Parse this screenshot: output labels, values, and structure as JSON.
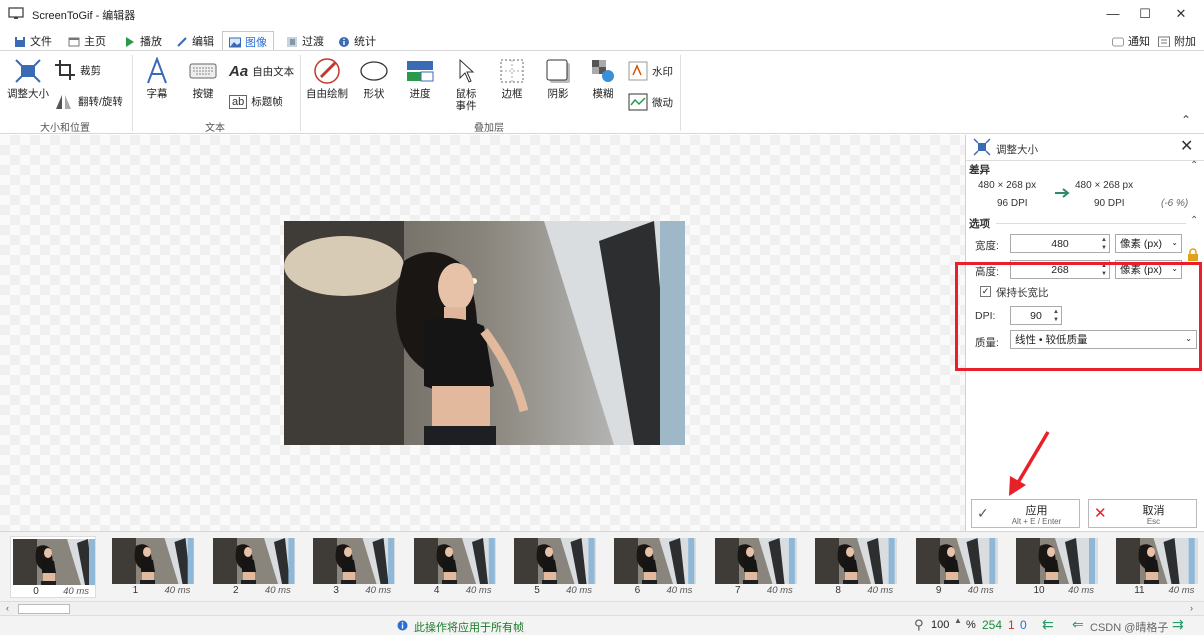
{
  "window": {
    "title": "ScreenToGif - 编辑器",
    "controls": [
      "—",
      "☐",
      "✕"
    ]
  },
  "tabs": {
    "items": [
      {
        "label": "文件"
      },
      {
        "label": "主页"
      },
      {
        "label": "播放"
      },
      {
        "label": "编辑"
      },
      {
        "label": "图像"
      },
      {
        "label": "过渡"
      },
      {
        "label": "统计"
      }
    ],
    "active": "图像",
    "right": {
      "notify": "通知",
      "extra": "附加"
    }
  },
  "ribbon": {
    "size_group": {
      "label": "大小和位置",
      "resize": "调整大小",
      "crop": "裁剪",
      "flip": "翻转/旋转"
    },
    "text_group": {
      "label": "文本",
      "caption": "字幕",
      "keys": "按键",
      "free_text": "自由文本",
      "title_frame": "标题帧",
      "free_text_icon": "Aa",
      "title_frame_icon": "ab"
    },
    "overlay_group": {
      "label": "叠加层",
      "free_draw": "自由绘制",
      "shape": "形状",
      "progress": "进度",
      "mouse_events": "鼠标\n事件",
      "border": "边框",
      "shadow": "阴影",
      "blur": "模糊",
      "watermark": "水印",
      "cinemagraph": "微动"
    }
  },
  "panel": {
    "title": "调整大小",
    "diff_header": "差异",
    "orig_size": "480  ×  268 px",
    "orig_dpi": "96 DPI",
    "new_size": "480  ×  268 px",
    "new_dpi": "90 DPI",
    "change": "(-6 %)",
    "options_header": "选项",
    "width_label": "宽度:",
    "width_value": "480",
    "height_label": "高度:",
    "height_value": "268",
    "unit": "像素 (px)",
    "keep_ratio": "保持长宽比",
    "dpi_label": "DPI:",
    "dpi_value": "90",
    "quality_label": "质量:",
    "quality_value": "线性 • 较低质量",
    "apply": "应用",
    "apply_hint": "Alt + E / Enter",
    "cancel": "取消",
    "cancel_hint": "Esc",
    "highlight_color": "#e8202a"
  },
  "frames": [
    {
      "num": "0",
      "dur": "40 ms"
    },
    {
      "num": "1",
      "dur": "40 ms"
    },
    {
      "num": "2",
      "dur": "40 ms"
    },
    {
      "num": "3",
      "dur": "40 ms"
    },
    {
      "num": "4",
      "dur": "40 ms"
    },
    {
      "num": "5",
      "dur": "40 ms"
    },
    {
      "num": "6",
      "dur": "40 ms"
    },
    {
      "num": "7",
      "dur": "40 ms"
    },
    {
      "num": "8",
      "dur": "40 ms"
    },
    {
      "num": "9",
      "dur": "40 ms"
    },
    {
      "num": "10",
      "dur": "40 ms"
    },
    {
      "num": "11",
      "dur": "40 ms"
    }
  ],
  "status": {
    "message": "此操作将应用于所有帧",
    "zoom": "100",
    "zoom_unit": "%",
    "frame_count": "254",
    "selected": "1",
    "current": "0",
    "watermark": "CSDN @晴格子"
  }
}
